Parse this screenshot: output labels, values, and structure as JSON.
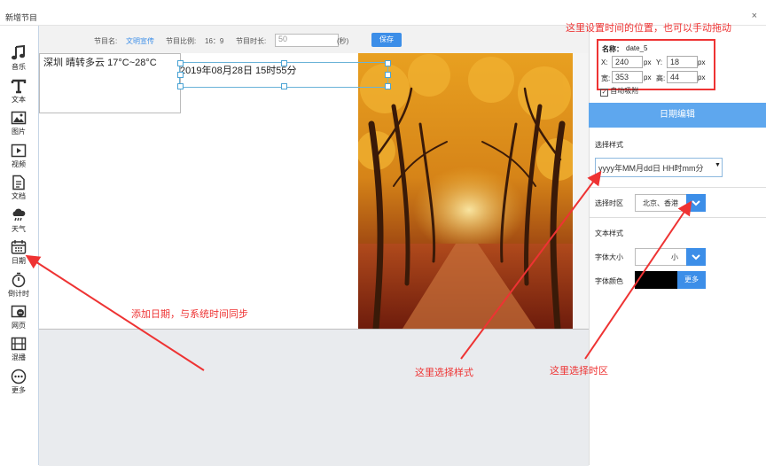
{
  "window": {
    "title": "新增节目",
    "close": "×"
  },
  "sidebar": {
    "items": [
      {
        "label": "音乐",
        "icon": "music-icon"
      },
      {
        "label": "文本",
        "icon": "text-icon"
      },
      {
        "label": "图片",
        "icon": "image-icon"
      },
      {
        "label": "视频",
        "icon": "video-icon"
      },
      {
        "label": "文档",
        "icon": "document-icon"
      },
      {
        "label": "天气",
        "icon": "weather-icon"
      },
      {
        "label": "日期",
        "icon": "calendar-icon"
      },
      {
        "label": "倒计时",
        "icon": "timer-icon"
      },
      {
        "label": "网页",
        "icon": "webpage-icon"
      },
      {
        "label": "混播",
        "icon": "mixed-play-icon"
      },
      {
        "label": "更多",
        "icon": "more-icon"
      }
    ]
  },
  "toolbar": {
    "name_label": "节目名:",
    "name_value": "文明宣传",
    "ratio_label": "节目比例:",
    "ratio_value": "16：9",
    "duration_label": "节目时长:",
    "duration_value": "50",
    "duration_unit": "(秒)",
    "save_label": "保存"
  },
  "canvas": {
    "weather_text": "深圳   晴转多云    17°C~28°C",
    "date_text": "2019年08月28日  15时55分"
  },
  "panel": {
    "name_label": "名称：",
    "name_value": "date_5",
    "x_label": "X:",
    "x_value": "240",
    "y_label": "Y:",
    "y_value": "18",
    "unit": "px",
    "width_label": "宽:",
    "width_value": "353",
    "height_label": "高:",
    "height_value": "44",
    "auto_snap_label": "自动吸附",
    "date_edit_title": "日期编辑",
    "style_label": "选择样式",
    "style_value": "yyyy年MM月dd日 HH时mm分",
    "timezone_label": "选择时区",
    "timezone_value": "北京、香港",
    "text_style_label": "文本样式",
    "font_size_label": "字体大小",
    "font_size_value": "小",
    "font_color_label": "字体颜色",
    "font_color": "#000000",
    "more_label": "更多"
  },
  "annotations": {
    "position_note": "这里设置时间的位置，也可以手动拖动",
    "add_date_note": "添加日期，与系统时间同步",
    "style_note": "这里选择样式",
    "timezone_note": "这里选择时区"
  },
  "colors": {
    "accent": "#3c8ee8",
    "header_bar": "#5ea7ee",
    "annotation": "#e33333"
  }
}
